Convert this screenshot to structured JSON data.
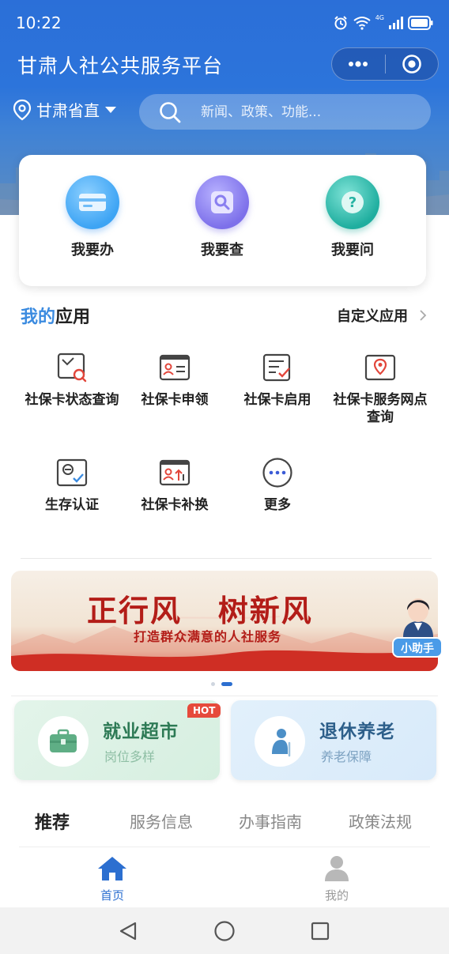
{
  "status_bar": {
    "time": "10:22",
    "network": "4G"
  },
  "header": {
    "title": "甘肃人社公共服务平台",
    "location": "甘肃省直",
    "search_placeholder": "新闻、政策、功能..."
  },
  "quick_actions": [
    {
      "label": "我要办",
      "icon": "card-icon"
    },
    {
      "label": "我要查",
      "icon": "search-icon"
    },
    {
      "label": "我要问",
      "icon": "question-icon"
    }
  ],
  "my_apps": {
    "title_accent": "我的",
    "title_rest": "应用",
    "customize_label": "自定义应用",
    "items": [
      {
        "label": "社保卡状态查询",
        "icon": "card-status-icon"
      },
      {
        "label": "社保卡申领",
        "icon": "card-apply-icon"
      },
      {
        "label": "社保卡启用",
        "icon": "card-enable-icon"
      },
      {
        "label": "社保卡服务网点查询",
        "icon": "location-card-icon"
      },
      {
        "label": "生存认证",
        "icon": "face-verify-icon"
      },
      {
        "label": "社保卡补换",
        "icon": "card-replace-icon"
      },
      {
        "label": "更多",
        "icon": "more-icon"
      }
    ]
  },
  "banner": {
    "title": "正行风   树新风",
    "subtitle": "打造群众满意的人社服务",
    "assistant_label": "小助手",
    "slide_index": 2,
    "slide_count": 2
  },
  "service_cards": [
    {
      "title": "就业超市",
      "subtitle": "岗位多样",
      "badge": "HOT",
      "icon": "briefcase-icon",
      "color": "#2d7a55"
    },
    {
      "title": "退休养老",
      "subtitle": "养老保障",
      "icon": "elder-icon",
      "color": "#2d5f8a"
    }
  ],
  "tabs": [
    {
      "label": "推荐",
      "active": true
    },
    {
      "label": "服务信息",
      "active": false
    },
    {
      "label": "办事指南",
      "active": false
    },
    {
      "label": "政策法规",
      "active": false
    }
  ],
  "bottom_nav": [
    {
      "label": "首页",
      "active": true,
      "color": "#2c6fd0"
    },
    {
      "label": "我的",
      "active": false,
      "color": "#9a9a9a"
    }
  ],
  "colors": {
    "primary": "#2c6fd0",
    "accent": "#3b8be0",
    "hot": "#e64a3b",
    "banner_red": "#b31d18"
  }
}
